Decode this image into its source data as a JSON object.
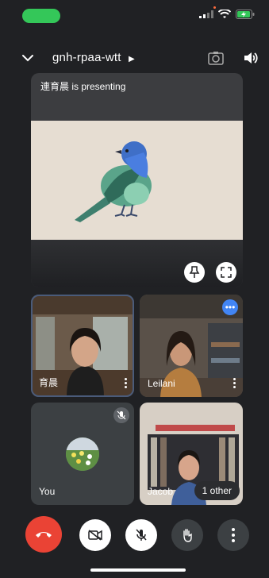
{
  "meeting": {
    "code": "gnh-rpaa-wtt"
  },
  "presenting": {
    "label": "連育晨 is presenting"
  },
  "participants": [
    {
      "name": "育晨"
    },
    {
      "name": "Leilani"
    },
    {
      "name": "You"
    },
    {
      "name": "Jacob"
    }
  ],
  "others": {
    "label": "1 other"
  },
  "icons": {
    "collapse": "chevron-down-icon",
    "switch_camera": "switch-camera-icon",
    "speaker": "speaker-icon",
    "pin": "pin-icon",
    "fullscreen": "fullscreen-icon",
    "end_call": "end-call-icon",
    "camera_off": "camera-off-icon",
    "mic_off": "mic-off-icon",
    "raise_hand": "raise-hand-icon",
    "more": "more-icon"
  },
  "colors": {
    "end_call": "#ea4335",
    "battery": "#34c759",
    "blue_badge": "#4285f4"
  }
}
